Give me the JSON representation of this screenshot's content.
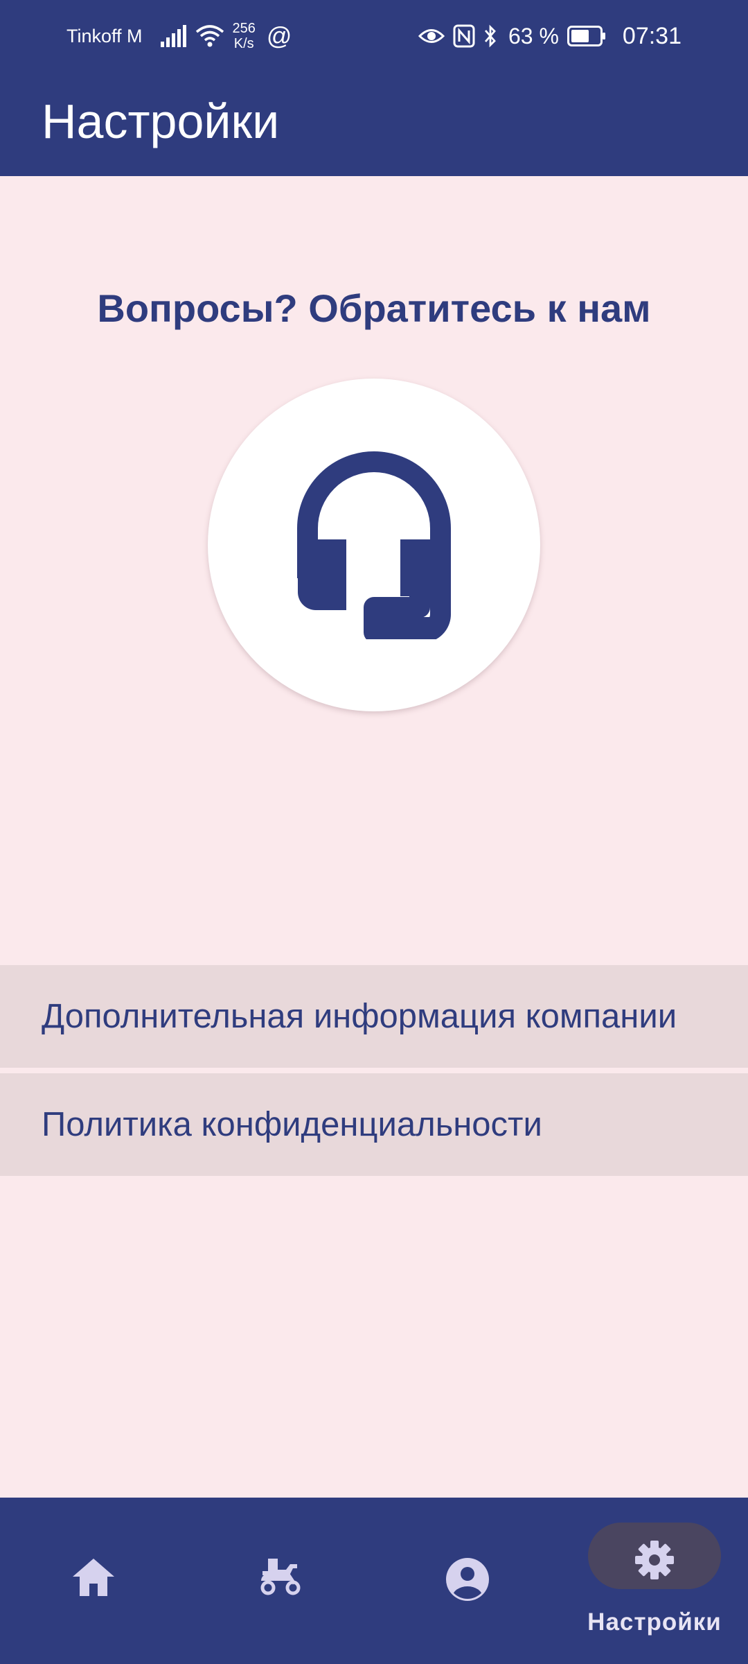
{
  "status_bar": {
    "carrier": "Tinkoff M",
    "speed_value": "256",
    "speed_unit": "K/s",
    "at_symbol": "@",
    "battery": "63 %",
    "time": "07:31"
  },
  "app_bar": {
    "title": "Настройки"
  },
  "main": {
    "heading": "Вопросы? Обратитесь к нам",
    "support_icon": "headset-icon"
  },
  "menu": {
    "items": [
      {
        "label": "Дополнительная информация компании"
      },
      {
        "label": "Политика конфиденциальности"
      }
    ]
  },
  "bottom_nav": {
    "items": [
      {
        "icon": "home-icon",
        "label": ""
      },
      {
        "icon": "scooter-icon",
        "label": ""
      },
      {
        "icon": "account-circle-icon",
        "label": ""
      },
      {
        "icon": "gear-icon",
        "label": "Настройки",
        "active": true
      }
    ]
  },
  "colors": {
    "primary": "#2f3c7e",
    "background": "#fbe9ec",
    "menu_item_bg": "#e8d8da",
    "nav_active_pill": "#4a4560",
    "nav_icon": "#d6d2ee"
  }
}
